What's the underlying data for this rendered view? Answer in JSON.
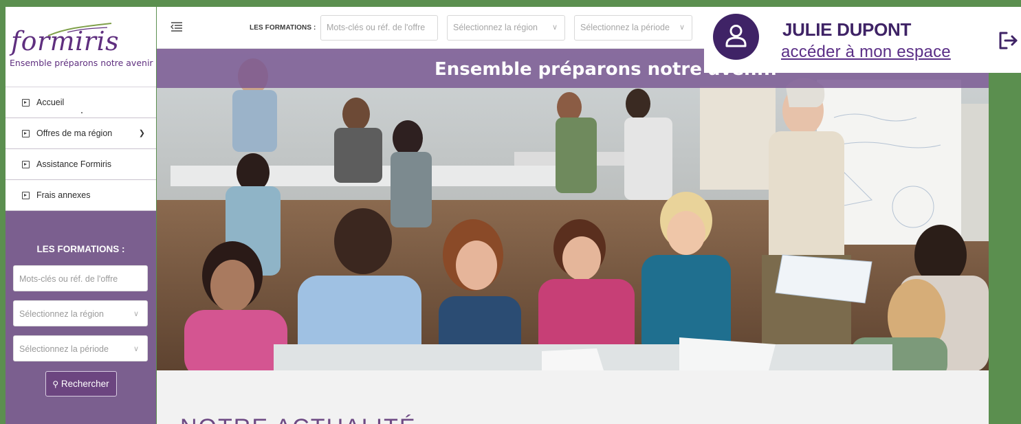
{
  "sidebar": {
    "logo_word": "formiris",
    "logo_tagline": "Ensemble préparons notre avenir",
    "menu": [
      {
        "label": "Accueil",
        "icon": "arrow-box-icon"
      },
      {
        "label": "Offres de ma région",
        "icon": "arrow-box-icon",
        "chevron": "chevron-down-icon"
      },
      {
        "label": "Assistance Formiris",
        "icon": "arrow-box-icon"
      },
      {
        "label": "Frais annexes",
        "icon": "arrow-box-icon"
      }
    ],
    "form_title": "LES FORMATIONS :",
    "keywords_placeholder": "Mots-clés ou réf. de l'offre",
    "region_placeholder": "Sélectionnez la région",
    "period_placeholder": "Sélectionnez la période",
    "search_button": "Rechercher"
  },
  "topbar": {
    "label": "LES FORMATIONS :",
    "keywords_placeholder": "Mots-clés ou réf. de l'offre",
    "region_placeholder": "Sélectionnez la région",
    "period_placeholder": "Sélectionnez la période"
  },
  "hero": {
    "title": "Ensemble préparons notre aven..."
  },
  "content": {
    "section_title": "NOTRE ACTUALITÉ"
  },
  "user": {
    "name": "JULIE DUPONT",
    "link": "accéder à mon espace"
  },
  "colors": {
    "page_bg": "#5b8f4f",
    "brand_purple": "#5f2f7f",
    "sidebar_purple": "#7b5f8f",
    "avatar_bg": "#3f2366"
  }
}
